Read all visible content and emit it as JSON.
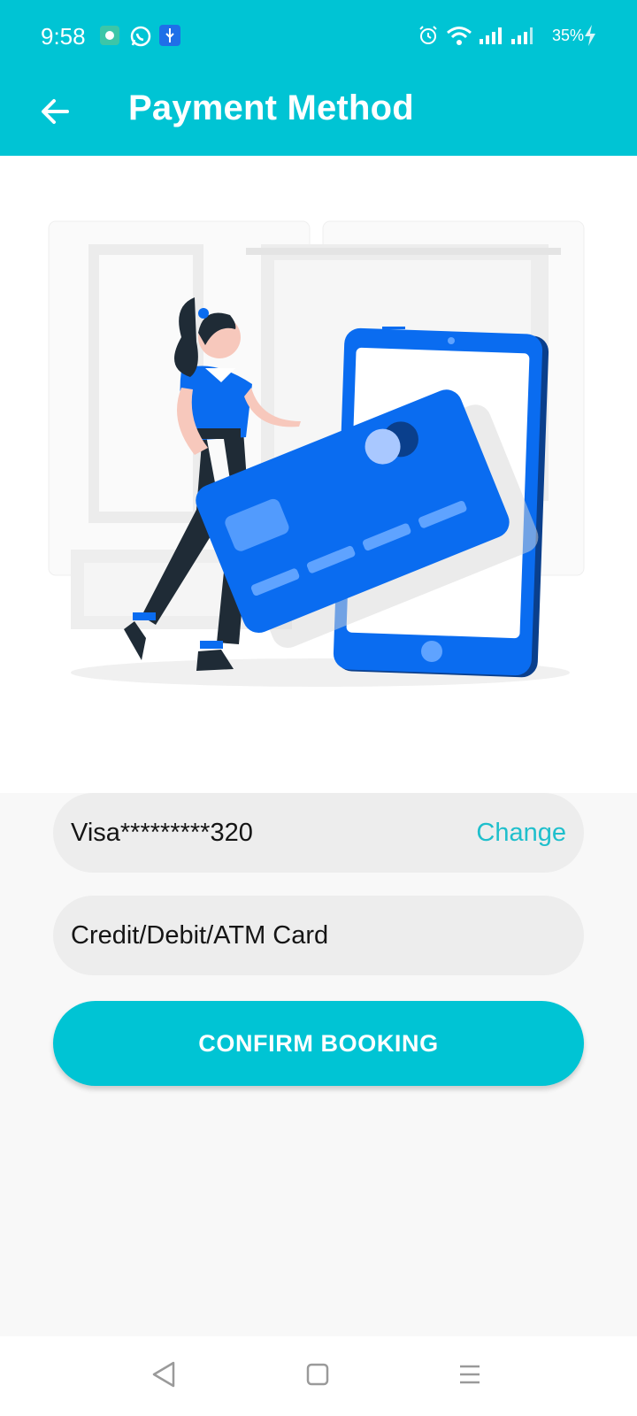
{
  "status_bar": {
    "time": "9:58",
    "battery": "35%",
    "icons": [
      "app-notification-icon",
      "whatsapp-icon",
      "usb-icon",
      "alarm-icon",
      "wifi-icon",
      "signal-icon",
      "signal-icon-2",
      "charging-icon"
    ]
  },
  "header": {
    "title": "Payment Method",
    "back_icon": "arrow-left-icon"
  },
  "payment": {
    "saved_card": "Visa*********320",
    "change_label": "Change",
    "other_option": "Credit/Debit/ATM Card"
  },
  "actions": {
    "confirm_label": "CONFIRM BOOKING"
  },
  "navigation": {
    "icons": [
      "back-triangle-icon",
      "home-square-icon",
      "menu-lines-icon"
    ]
  },
  "colors": {
    "accent": "#00c4d4",
    "illustration_blue": "#0a6cf0",
    "field_bg": "#ededed"
  }
}
